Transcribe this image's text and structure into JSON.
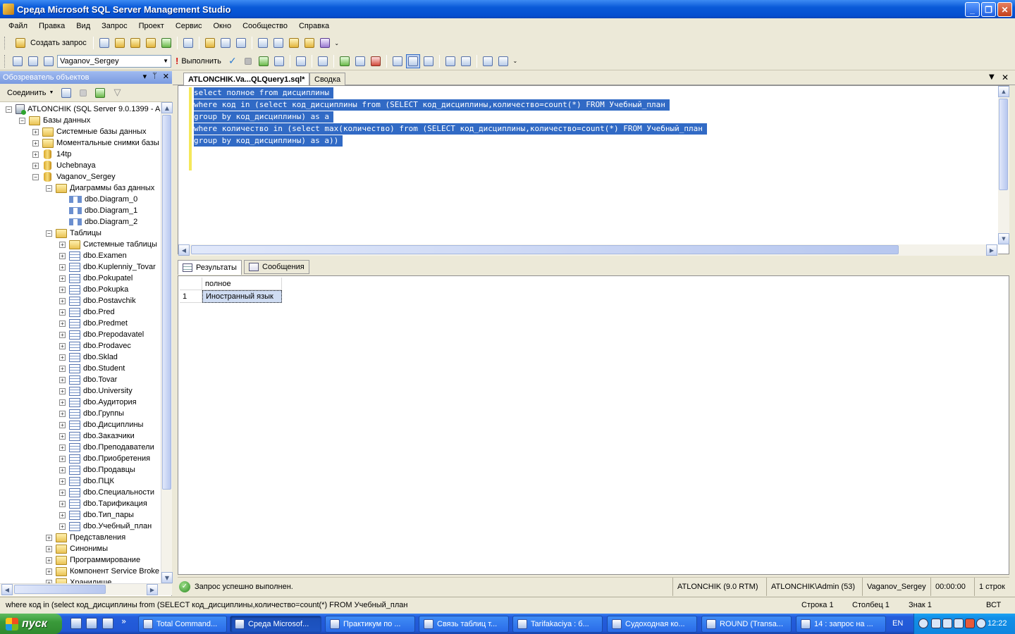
{
  "window": {
    "title": "Среда Microsoft SQL Server Management Studio",
    "buttons": {
      "minimize": "_",
      "maximize": "❐",
      "close": "✕"
    }
  },
  "menu": [
    "Файл",
    "Правка",
    "Вид",
    "Запрос",
    "Проект",
    "Сервис",
    "Окно",
    "Сообщество",
    "Справка"
  ],
  "toolbar1": {
    "new_query": "Создать запрос"
  },
  "toolbar2": {
    "database": "Vaganov_Sergey",
    "execute": "Выполнить"
  },
  "object_explorer": {
    "title": "Обозреватель объектов",
    "connect": "Соединить",
    "tree": [
      {
        "label": "ATLONCHIK (SQL Server 9.0.1399 - A",
        "level": 0,
        "icon": "server-icon",
        "exp": "−"
      },
      {
        "label": "Базы данных",
        "level": 1,
        "icon": "folder-icon",
        "exp": "−"
      },
      {
        "label": "Системные базы данных",
        "level": 2,
        "icon": "folder-icon",
        "exp": "+"
      },
      {
        "label": "Моментальные снимки базы",
        "level": 2,
        "icon": "folder-icon",
        "exp": "+"
      },
      {
        "label": "14tp",
        "level": 2,
        "icon": "database-icon",
        "exp": "+"
      },
      {
        "label": "Uchebnaya",
        "level": 2,
        "icon": "database-icon",
        "exp": "+"
      },
      {
        "label": "Vaganov_Sergey",
        "level": 2,
        "icon": "database-icon",
        "exp": "−"
      },
      {
        "label": "Диаграммы баз данных",
        "level": 3,
        "icon": "folder-icon",
        "exp": "−"
      },
      {
        "label": "dbo.Diagram_0",
        "level": 4,
        "icon": "diagram-icon",
        "exp": ""
      },
      {
        "label": "dbo.Diagram_1",
        "level": 4,
        "icon": "diagram-icon",
        "exp": ""
      },
      {
        "label": "dbo.Diagram_2",
        "level": 4,
        "icon": "diagram-icon",
        "exp": ""
      },
      {
        "label": "Таблицы",
        "level": 3,
        "icon": "folder-icon",
        "exp": "−"
      },
      {
        "label": "Системные таблицы",
        "level": 4,
        "icon": "folder-icon",
        "exp": "+"
      },
      {
        "label": "dbo.Examen",
        "level": 4,
        "icon": "table-icon",
        "exp": "+"
      },
      {
        "label": "dbo.Kuplenniy_Tovar",
        "level": 4,
        "icon": "table-icon",
        "exp": "+"
      },
      {
        "label": "dbo.Pokupatel",
        "level": 4,
        "icon": "table-icon",
        "exp": "+"
      },
      {
        "label": "dbo.Pokupka",
        "level": 4,
        "icon": "table-icon",
        "exp": "+"
      },
      {
        "label": "dbo.Postavchik",
        "level": 4,
        "icon": "table-icon",
        "exp": "+"
      },
      {
        "label": "dbo.Pred",
        "level": 4,
        "icon": "table-icon",
        "exp": "+"
      },
      {
        "label": "dbo.Predmet",
        "level": 4,
        "icon": "table-icon",
        "exp": "+"
      },
      {
        "label": "dbo.Prepodavatel",
        "level": 4,
        "icon": "table-icon",
        "exp": "+"
      },
      {
        "label": "dbo.Prodavec",
        "level": 4,
        "icon": "table-icon",
        "exp": "+"
      },
      {
        "label": "dbo.Sklad",
        "level": 4,
        "icon": "table-icon",
        "exp": "+"
      },
      {
        "label": "dbo.Student",
        "level": 4,
        "icon": "table-icon",
        "exp": "+"
      },
      {
        "label": "dbo.Tovar",
        "level": 4,
        "icon": "table-icon",
        "exp": "+"
      },
      {
        "label": "dbo.University",
        "level": 4,
        "icon": "table-icon",
        "exp": "+"
      },
      {
        "label": "dbo.Аудитория",
        "level": 4,
        "icon": "table-icon",
        "exp": "+"
      },
      {
        "label": "dbo.Группы",
        "level": 4,
        "icon": "table-icon",
        "exp": "+"
      },
      {
        "label": "dbo.Дисциплины",
        "level": 4,
        "icon": "table-icon",
        "exp": "+"
      },
      {
        "label": "dbo.Заказчики",
        "level": 4,
        "icon": "table-icon",
        "exp": "+"
      },
      {
        "label": "dbo.Преподаватели",
        "level": 4,
        "icon": "table-icon",
        "exp": "+"
      },
      {
        "label": "dbo.Приобретения",
        "level": 4,
        "icon": "table-icon",
        "exp": "+"
      },
      {
        "label": "dbo.Продавцы",
        "level": 4,
        "icon": "table-icon",
        "exp": "+"
      },
      {
        "label": "dbo.ПЦК",
        "level": 4,
        "icon": "table-icon",
        "exp": "+"
      },
      {
        "label": "dbo.Специальности",
        "level": 4,
        "icon": "table-icon",
        "exp": "+"
      },
      {
        "label": "dbo.Тарификация",
        "level": 4,
        "icon": "table-icon",
        "exp": "+"
      },
      {
        "label": "dbo.Тип_пары",
        "level": 4,
        "icon": "table-icon",
        "exp": "+"
      },
      {
        "label": "dbo.Учебный_план",
        "level": 4,
        "icon": "table-icon",
        "exp": "+"
      },
      {
        "label": "Представления",
        "level": 3,
        "icon": "folder-icon",
        "exp": "+"
      },
      {
        "label": "Синонимы",
        "level": 3,
        "icon": "folder-icon",
        "exp": "+"
      },
      {
        "label": "Программирование",
        "level": 3,
        "icon": "folder-icon",
        "exp": "+"
      },
      {
        "label": "Компонент Service Broke",
        "level": 3,
        "icon": "folder-icon",
        "exp": "+"
      },
      {
        "label": "Хранилище",
        "level": 3,
        "icon": "folder-icon",
        "exp": "+"
      }
    ]
  },
  "doc_tabs": {
    "query_tab": "ATLONCHIK.Va...QLQuery1.sql*",
    "summary_tab": "Сводка"
  },
  "editor": {
    "lines": [
      "select полное from дисциплины",
      "where код in (select код_дисциплины from (SELECT код_дисциплины,количество=count(*) FROM Учебный_план",
      "group by код_дисциплины) as a",
      "where количество in (select max(количество) from (SELECT код_дисциплины,количество=count(*) FROM Учебный_план",
      "group by код_дисциплины) as a))"
    ]
  },
  "results": {
    "tabs": [
      "Результаты",
      "Сообщения"
    ],
    "columns": [
      "полное"
    ],
    "rows": [
      {
        "num": "1",
        "values": [
          "Иностранный язык"
        ]
      }
    ]
  },
  "query_status": {
    "message": "Запрос успешно выполнен.",
    "server": "ATLONCHIK (9.0 RTM)",
    "user": "ATLONCHIK\\Admin (53)",
    "database": "Vaganov_Sergey",
    "time": "00:00:00",
    "rows": "1 строк"
  },
  "statusbar": {
    "text": "where код in (select код_дисциплины from (SELECT код_дисциплины,количество=count(*) FROM Учебный_план",
    "line": "Строка 1",
    "col": "Столбец 1",
    "char": "Знак 1",
    "mode": "ВСТ"
  },
  "taskbar": {
    "start": "пуск",
    "quick_more": "»",
    "tasks": [
      "Total Command...",
      "Среда Microsof...",
      "Практикум по ...",
      "Связь таблиц т...",
      "Tarifakaciya : б...",
      "Судоходная ко...",
      "ROUND (Transa...",
      "14 : запрос на ..."
    ],
    "active_task": 1,
    "lang": "EN",
    "clock": "12:22"
  },
  "colors": {
    "selection": "#316ac5",
    "title_blue": "#0a5ad8",
    "gutter_yellow": "#f5e85a"
  }
}
